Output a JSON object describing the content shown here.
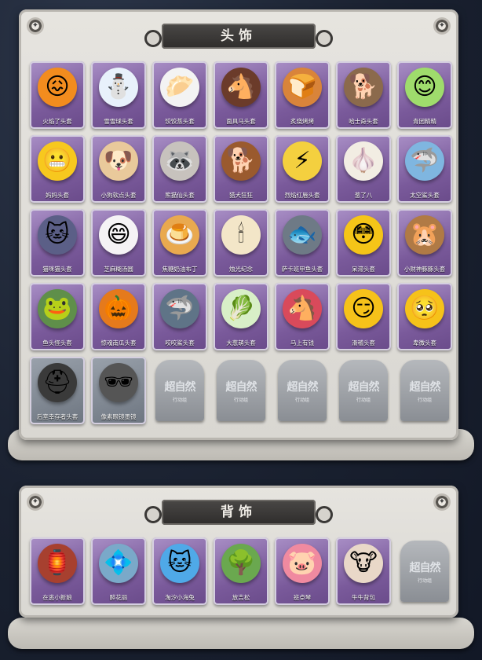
{
  "sections": {
    "head": {
      "title": "头饰"
    },
    "back": {
      "title": "背饰"
    }
  },
  "watermark": {
    "main": "超自然",
    "sub": "行动组"
  },
  "colors": {
    "card_purple": "#7a5a9b",
    "panel": "#e3e1dc",
    "background": "#1c2433",
    "title_plate": "#3a3836"
  },
  "head_items": [
    {
      "label": "火焰了头套",
      "icon": "fire-head-icon",
      "glyph": "😖",
      "bg": "#f28c1e"
    },
    {
      "label": "雪雪球头套",
      "icon": "snowman-head-icon",
      "glyph": "⛄",
      "bg": "#e8f1fb"
    },
    {
      "label": "饺饺蒸头套",
      "icon": "dumpling-head-icon",
      "glyph": "🥟",
      "bg": "#f3f3f3"
    },
    {
      "label": "面具马头套",
      "icon": "horse-head-icon",
      "glyph": "🐴",
      "bg": "#6b3b2a"
    },
    {
      "label": "炙烧烤烤",
      "icon": "toast-head-icon",
      "glyph": "🍞",
      "bg": "#d9843a"
    },
    {
      "label": "哈士奇头套",
      "icon": "husky-head-icon",
      "glyph": "🐕",
      "bg": "#8b6a4c"
    },
    {
      "label": "青团精精",
      "icon": "green-bun-head-icon",
      "glyph": "😊",
      "bg": "#9fdc6c"
    },
    {
      "label": "妈妈头套",
      "icon": "grin-emoji-head-icon",
      "glyph": "😬",
      "bg": "#f7c81e"
    },
    {
      "label": "小狗软点头套",
      "icon": "dog-plush-head-icon",
      "glyph": "🐶",
      "bg": "#e9c99b"
    },
    {
      "label": "熊猫仙头套",
      "icon": "raccoon-head-icon",
      "glyph": "🦝",
      "bg": "#c7c2bd"
    },
    {
      "label": "猎犬狂狂",
      "icon": "hound-head-icon",
      "glyph": "🐕",
      "bg": "#9a5a2e"
    },
    {
      "label": "烈焰红唇头套",
      "icon": "pikachu-head-icon",
      "glyph": "⚡",
      "bg": "#f4d03f"
    },
    {
      "label": "葱了八",
      "icon": "garlic-head-icon",
      "glyph": "🧄",
      "bg": "#f2ede3"
    },
    {
      "label": "太空鲨头套",
      "icon": "shark-plush-head-icon",
      "glyph": "🦈",
      "bg": "#7fb6e0"
    },
    {
      "label": "猫咪猫头套",
      "icon": "cat-head-icon",
      "glyph": "🐱",
      "bg": "#5b5f87"
    },
    {
      "label": "芝麻糊汤圆",
      "icon": "rice-ball-head-icon",
      "glyph": "😄",
      "bg": "#f5f3f5"
    },
    {
      "label": "焦糖奶油布丁",
      "icon": "pudding-head-icon",
      "glyph": "🍮",
      "bg": "#e9a94f"
    },
    {
      "label": "烛光纪念",
      "icon": "candle-head-icon",
      "glyph": "🕯",
      "bg": "#f3e6c8"
    },
    {
      "label": "萨卡班甲鱼头套",
      "icon": "fish-head-icon",
      "glyph": "🐟",
      "bg": "#6e7a86"
    },
    {
      "label": "呆滞头套",
      "icon": "stare-emoji-head-icon",
      "glyph": "😳",
      "bg": "#f5c518"
    },
    {
      "label": "小财神豚豚头套",
      "icon": "capybara-head-icon",
      "glyph": "🐹",
      "bg": "#b07a45"
    },
    {
      "label": "鱼头怪头套",
      "icon": "fishman-head-icon",
      "glyph": "🐸",
      "bg": "#5f8f4a"
    },
    {
      "label": "惊魂南瓜头套",
      "icon": "pumpkin-head-icon",
      "glyph": "🎃",
      "bg": "#e57a1c"
    },
    {
      "label": "咬咬鲨头套",
      "icon": "shark-head-icon",
      "glyph": "🦈",
      "bg": "#5f7487"
    },
    {
      "label": "大葱萌头套",
      "icon": "bok-choy-head-icon",
      "glyph": "🥬",
      "bg": "#d8efc7"
    },
    {
      "label": "马上有钱",
      "icon": "pony-head-icon",
      "glyph": "🐴",
      "bg": "#d94a5b"
    },
    {
      "label": "滑稽头套",
      "icon": "smirk-emoji-head-icon",
      "glyph": "😏",
      "bg": "#f6c21a"
    },
    {
      "label": "卑微头套",
      "icon": "pleading-emoji-head-icon",
      "glyph": "🥺",
      "bg": "#f6c21a"
    },
    {
      "label": "后室幸存者头套",
      "icon": "gas-mask-head-icon",
      "glyph": "⛑",
      "bg": "#3a3a3a",
      "gray": true
    },
    {
      "label": "像素眼镜墨镜",
      "icon": "pixel-sunglasses-icon",
      "glyph": "🕶",
      "bg": "#555555",
      "gray": true
    }
  ],
  "back_items": [
    {
      "label": "在逃小新娘",
      "icon": "lamp-backpack-icon",
      "glyph": "🏮",
      "bg": "#a7402f"
    },
    {
      "label": "醉花丽",
      "icon": "flower-chandelier-icon",
      "glyph": "💠",
      "bg": "#7aa9c9"
    },
    {
      "label": "淘汐小海兔",
      "icon": "blue-cat-backpack-icon",
      "glyph": "🐱",
      "bg": "#4fa9e8"
    },
    {
      "label": "放吉松",
      "icon": "bonsai-backpack-icon",
      "glyph": "🌳",
      "bg": "#6aa84f"
    },
    {
      "label": "班卓琴",
      "icon": "pig-banjo-backpack-icon",
      "glyph": "🐷",
      "bg": "#f08aa0"
    },
    {
      "label": "牛牛背包",
      "icon": "cow-drum-backpack-icon",
      "glyph": "🐮",
      "bg": "#e9d8c8"
    }
  ],
  "head_locked_slots": 5,
  "back_locked_slots": 1
}
